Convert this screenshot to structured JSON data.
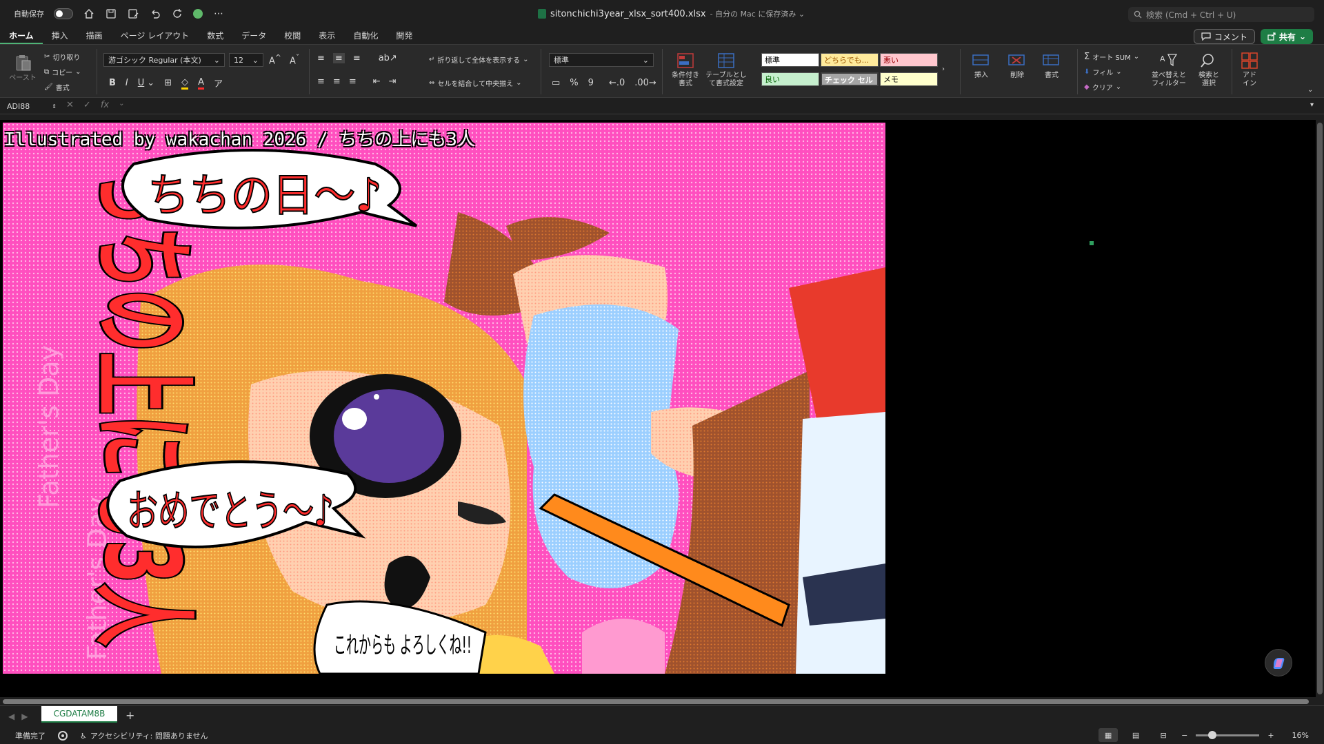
{
  "titlebar": {
    "autosave_label": "自動保存",
    "file_name": "sitonchichi3year_xlsx_sort400.xlsx",
    "save_status": "- 自分の Mac に保存済み ⌄",
    "search_placeholder": "検索 (Cmd + Ctrl + U)"
  },
  "tabs": [
    {
      "label": "ホーム",
      "active": true
    },
    {
      "label": "挿入"
    },
    {
      "label": "描画"
    },
    {
      "label": "ページ レイアウト"
    },
    {
      "label": "数式"
    },
    {
      "label": "データ"
    },
    {
      "label": "校閲"
    },
    {
      "label": "表示"
    },
    {
      "label": "自動化"
    },
    {
      "label": "開発"
    }
  ],
  "header_buttons": {
    "comment": "コメント",
    "share": "共有"
  },
  "ribbon": {
    "paste": "ペースト",
    "cut": "切り取り",
    "copy": "コピー",
    "format_painter": "書式",
    "font_name": "游ゴシック Regular (本文)",
    "font_size": "12",
    "wrap_text": "折り返して全体を表示する",
    "merge_center": "セルを結合して中央揃え",
    "number_format": "標準",
    "conditional_format": "条件付き\n書式",
    "format_as_table": "テーブルとして書式設定",
    "styles": {
      "normal": "標準",
      "neutral": "どちらでも...",
      "bad": "悪い",
      "good": "良い",
      "check_cell": "チェック セル",
      "note": "メモ"
    },
    "insert": "挿入",
    "delete": "削除",
    "format": "書式",
    "autosum": "オート SUM",
    "fill": "フィル",
    "clear": "クリア",
    "sort_filter": "並べ替えと\nフィルター",
    "find_select": "検索と\n選択",
    "addins": "アド\nイン"
  },
  "formula_bar": {
    "name_box": "ADI88",
    "fx": "fx"
  },
  "artwork": {
    "caption": "Illustrated by wakachan 2026 / ちちの上にも3人",
    "vertical_title": "ちちの上にも3人",
    "bubble_top": "ちちの日～♪",
    "bubble_bottom": "おめでとう～♪",
    "bubble_side": "これからも よろしくね!!",
    "background_text": "Father's Day"
  },
  "sheet_tab": "CGDATAM8B",
  "status": {
    "ready": "準備完了",
    "accessibility": "アクセシビリティ: 問題ありません",
    "zoom": "16%"
  },
  "colors": {
    "accent_green": "#1e7d45",
    "art_pink": "#ff4fbf",
    "style_neutral": "#ffeb9c",
    "style_bad": "#ffc7ce",
    "style_good": "#c6efce",
    "style_check": "#a5a5a5",
    "style_note": "#ffffcc"
  }
}
